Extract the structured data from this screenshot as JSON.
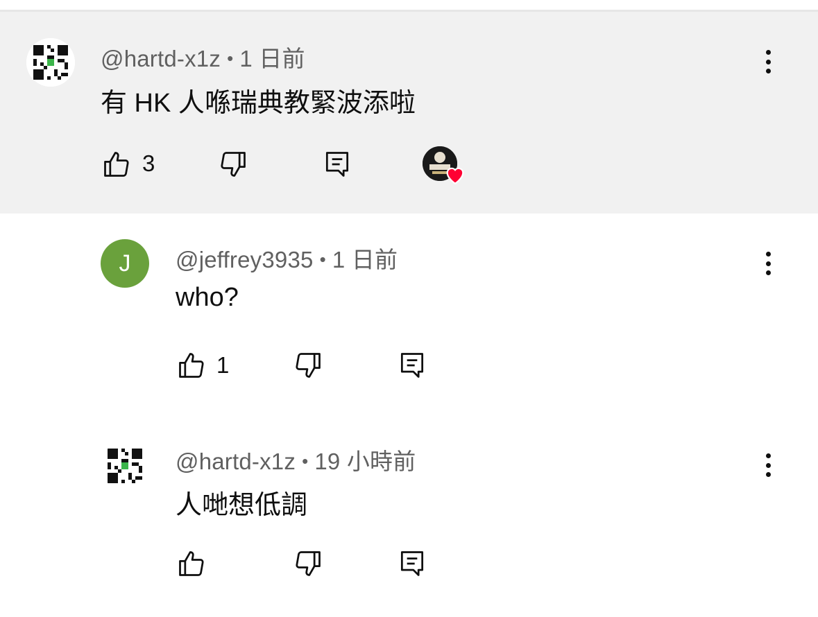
{
  "comments": [
    {
      "username": "@hartd-x1z",
      "separator": "•",
      "time": "1 日前",
      "text": "有 HK 人喺瑞典教緊波添啦",
      "likes": "3",
      "avatar_icon": "qr-code-avatar",
      "creator_heart": true
    },
    {
      "username": "@jeffrey3935",
      "separator": "•",
      "time": "1 日前",
      "text": "who?",
      "likes": "1",
      "avatar_letter": "J",
      "avatar_color": "#6aa13c"
    },
    {
      "username": "@hartd-x1z",
      "separator": "•",
      "time": "19 小時前",
      "text": "人哋想低調",
      "likes": "",
      "avatar_icon": "qr-code-avatar"
    }
  ],
  "colors": {
    "highlight_bg": "#f1f1f1",
    "meta_text": "#606060",
    "heart": "#ff0033"
  }
}
